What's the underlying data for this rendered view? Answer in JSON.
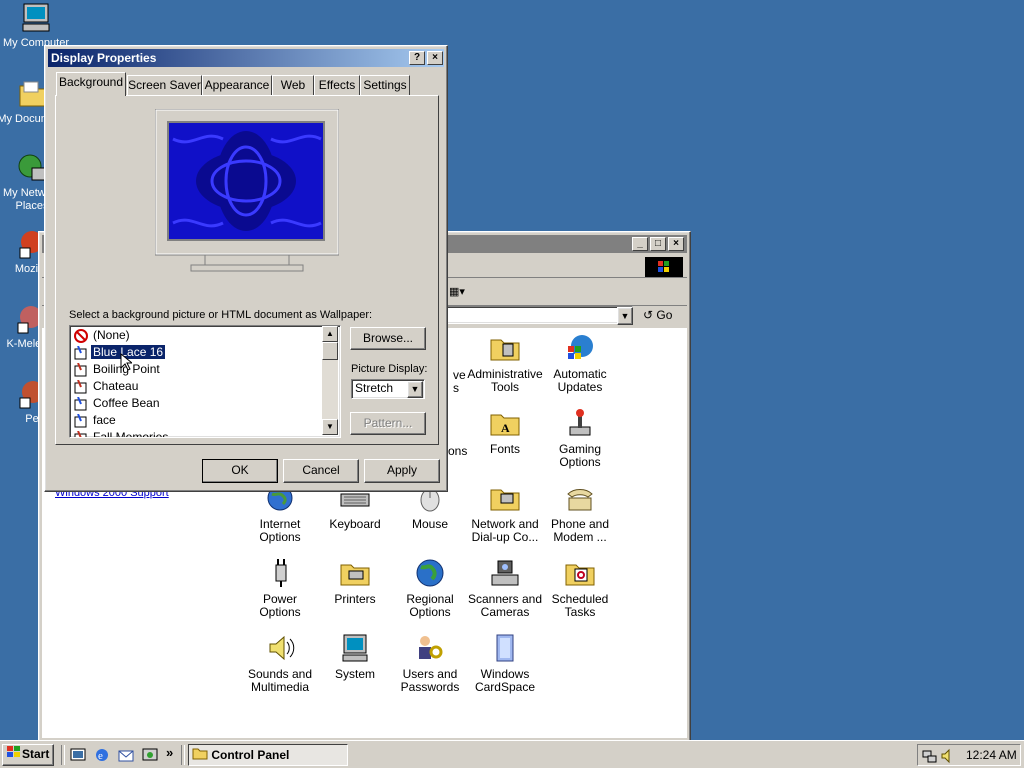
{
  "desktop": {
    "icons": [
      {
        "label": "My Computer",
        "icon": "computer-icon"
      },
      {
        "label": "My Documents",
        "icon": "folder-icon"
      },
      {
        "label": "My Network Places",
        "icon": "network-icon"
      },
      {
        "label": "Mozilla",
        "icon": "mozilla-icon"
      },
      {
        "label": "K-Meleon",
        "icon": "k-meleon-icon"
      },
      {
        "label": "Pe",
        "icon": "program-icon"
      }
    ]
  },
  "control_panel": {
    "title": "Control Panel",
    "go_label": "Go",
    "link_text": "Windows 2000 Support",
    "partial_labels": [
      "ve",
      "s",
      "ons"
    ],
    "items": [
      {
        "label": "Administrative Tools",
        "icon": "admin-tools-icon"
      },
      {
        "label": "Automatic Updates",
        "icon": "windows-update-icon"
      },
      {
        "label": "Fonts",
        "icon": "fonts-folder-icon"
      },
      {
        "label": "Gaming Options",
        "icon": "joystick-icon"
      },
      {
        "label": "Internet Options",
        "icon": "globe-icon"
      },
      {
        "label": "Keyboard",
        "icon": "keyboard-icon"
      },
      {
        "label": "Mouse",
        "icon": "mouse-icon"
      },
      {
        "label": "Network and Dial-up Co...",
        "icon": "network-folder-icon"
      },
      {
        "label": "Phone and Modem ...",
        "icon": "phone-icon"
      },
      {
        "label": "Power Options",
        "icon": "power-plug-icon"
      },
      {
        "label": "Printers",
        "icon": "printer-folder-icon"
      },
      {
        "label": "Regional Options",
        "icon": "globe-regional-icon"
      },
      {
        "label": "Scanners and Cameras",
        "icon": "scanner-icon"
      },
      {
        "label": "Scheduled Tasks",
        "icon": "scheduled-tasks-icon"
      },
      {
        "label": "Sounds and Multimedia",
        "icon": "speaker-icon"
      },
      {
        "label": "System",
        "icon": "system-computer-icon"
      },
      {
        "label": "Users and Passwords",
        "icon": "users-keys-icon"
      },
      {
        "label": "Windows CardSpace",
        "icon": "cardspace-icon"
      }
    ]
  },
  "dialog": {
    "title": "Display Properties",
    "help_glyph": "?",
    "close_glyph": "×",
    "tabs": [
      "Background",
      "Screen Saver",
      "Appearance",
      "Web",
      "Effects",
      "Settings"
    ],
    "active_tab": "Background",
    "wallpaper_prompt": "Select a background picture or HTML document as Wallpaper:",
    "wallpapers": [
      "(None)",
      "Blue Lace 16",
      "Boiling Point",
      "Chateau",
      "Coffee Bean",
      "face",
      "Fall Memories"
    ],
    "selected_wallpaper": "Blue Lace 16",
    "browse_label": "Browse...",
    "picture_display_label": "Picture Display:",
    "picture_display_value": "Stretch",
    "pattern_label": "Pattern...",
    "ok_label": "OK",
    "cancel_label": "Cancel",
    "apply_label": "Apply"
  },
  "taskbar": {
    "start_label": "Start",
    "chevron": "»",
    "task_label": "Control Panel",
    "clock": "12:24 AM"
  },
  "colors": {
    "desktop": "#3a6ea5",
    "title_active": "#0a246a",
    "face": "#d4d0c8",
    "selection": "#0a246a"
  }
}
